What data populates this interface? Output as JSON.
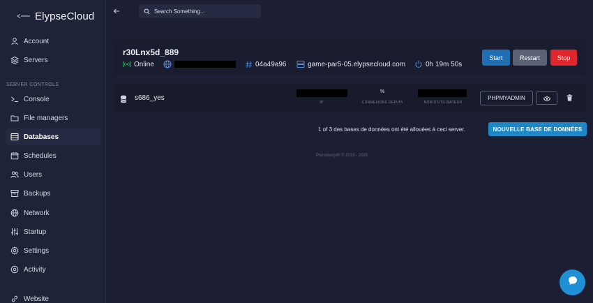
{
  "brand": {
    "name": "ElypseCloud"
  },
  "sidebar": {
    "account_items": [
      {
        "label": "Account",
        "icon": "user-icon"
      },
      {
        "label": "Servers",
        "icon": "layers-icon"
      }
    ],
    "section_label": "SERVER CONTROLS",
    "items": [
      {
        "label": "Console",
        "icon": "terminal-icon"
      },
      {
        "label": "File managers",
        "icon": "folder-icon"
      },
      {
        "label": "Databases",
        "icon": "database-icon",
        "active": true
      },
      {
        "label": "Schedules",
        "icon": "calendar-icon"
      },
      {
        "label": "Users",
        "icon": "users-icon"
      },
      {
        "label": "Backups",
        "icon": "archive-icon"
      },
      {
        "label": "Network",
        "icon": "globe-icon"
      },
      {
        "label": "Startup",
        "icon": "sliders-icon"
      },
      {
        "label": "Settings",
        "icon": "gear-icon"
      },
      {
        "label": "Activity",
        "icon": "eye-icon"
      },
      {
        "label": "Website",
        "icon": "link-icon"
      }
    ]
  },
  "search": {
    "placeholder": "Search Something..."
  },
  "server": {
    "name": "r30Lnx5d_889",
    "status": "Online",
    "id": "04a49a96",
    "node": "game-par5-05.elypsecloud.com",
    "uptime": "0h 19m 50s",
    "start_label": "Start",
    "restart_label": "Restart",
    "stop_label": "Stop"
  },
  "database": {
    "name": "s686_yes",
    "ip_label": "IP",
    "connections_value": "%",
    "connections_label": "CONNEXIONS DEPUIS",
    "username_label": "NOM D'UTILISATEUR",
    "phpmyadmin_label": "PHPMYADMIN"
  },
  "allocation_text": "1 of 3 des bases de données ont été allouées à ceci server.",
  "new_db_label": "NOUVELLE BASE DE DONNÉES",
  "footer": "Pterodactyl® © 2015 - 2025",
  "colors": {
    "start": "#1f6fb2",
    "restart": "#5c6275",
    "stop": "#e2262d",
    "online": "#22c55e",
    "accent": "#1e88c7"
  }
}
